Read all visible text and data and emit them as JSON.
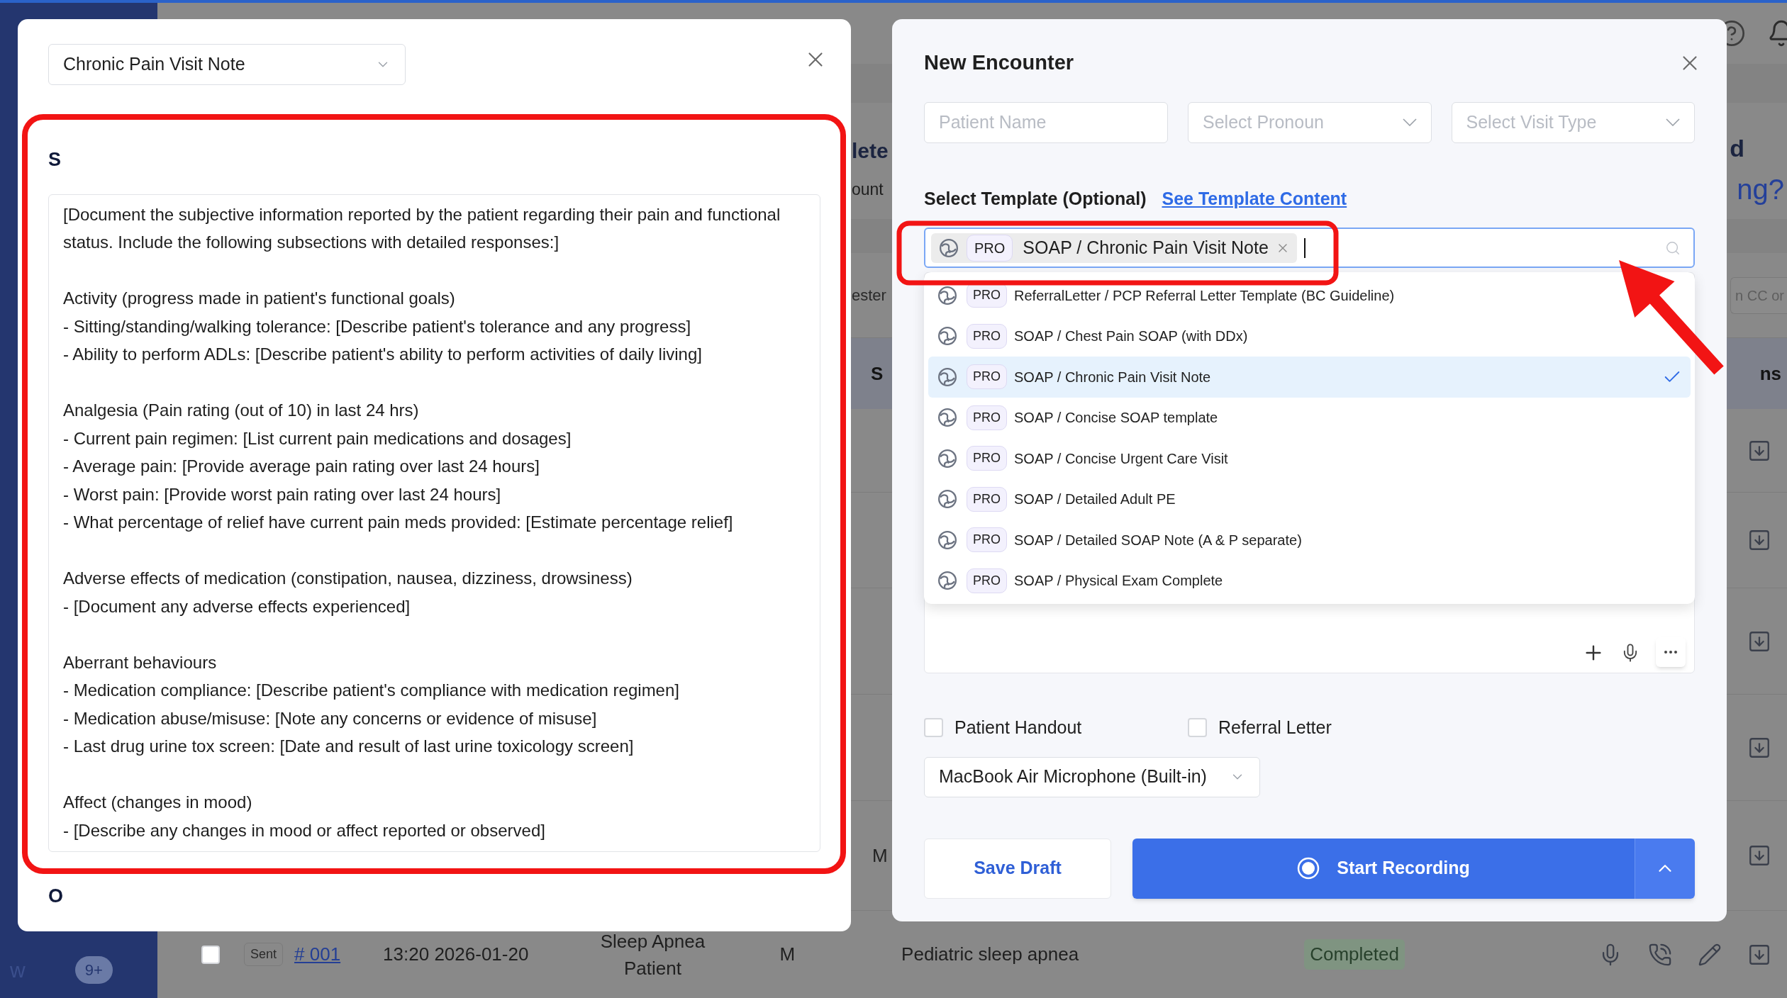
{
  "dashboard": {
    "header_left": "lete",
    "header_right": "d",
    "subheader_left": "ount",
    "question_right": "ng?",
    "filter_left": "ester",
    "filter_right": "n CC or",
    "table_header_left": "S",
    "table_header_right": "ns",
    "row_fragment": "M",
    "last_row": {
      "checked": false,
      "status": "Sent",
      "number": "# 001",
      "time": "13:20 2026-01-20",
      "patient": "Sleep Apnea Patient",
      "sex": "M",
      "reason": "Pediatric sleep apnea",
      "state": "Completed"
    },
    "sidebar_item": "w",
    "sidebar_badge": "9+"
  },
  "note_modal": {
    "template": "Chronic Pain Visit Note",
    "sections": [
      {
        "heading": "S",
        "body": "[Document the subjective information reported by the patient regarding their pain and functional status. Include the following subsections with detailed responses:]\n\nActivity (progress made in patient's functional goals)\n- Sitting/standing/walking tolerance: [Describe patient's tolerance and any progress]\n- Ability to perform ADLs: [Describe patient's ability to perform activities of daily living]\n\nAnalgesia (Pain rating (out of 10) in last 24 hrs)\n- Current pain regimen: [List current pain medications and dosages]\n- Average pain: [Provide average pain rating over last 24 hours]\n- Worst pain: [Provide worst pain rating over last 24 hours]\n- What percentage of relief have current pain meds provided: [Estimate percentage relief]\n\nAdverse effects of medication (constipation, nausea, dizziness, drowsiness)\n- [Document any adverse effects experienced]\n\nAberrant behaviours\n- Medication compliance: [Describe patient's compliance with medication regimen]\n- Medication abuse/misuse: [Note any concerns or evidence of misuse]\n- Last drug urine tox screen: [Date and result of last urine toxicology screen]\n\nAffect (changes in mood)\n- [Describe any changes in mood or affect reported or observed]"
      },
      {
        "heading": "O"
      }
    ]
  },
  "encounter_modal": {
    "title": "New Encounter",
    "fields": [
      {
        "kind": "text",
        "placeholder": "Patient Name"
      },
      {
        "kind": "select",
        "placeholder": "Select Pronoun"
      },
      {
        "kind": "select",
        "placeholder": "Select Visit Type"
      }
    ],
    "template_label": "Select Template (Optional)",
    "template_link": "See Template Content",
    "selected_template": {
      "badge": "PRO",
      "label": "SOAP / Chronic Pain Visit Note"
    },
    "options": [
      {
        "badge": "PRO",
        "label": "ReferralLetter / PCP Referral Letter Template (BC Guideline)",
        "selected": false
      },
      {
        "badge": "PRO",
        "label": "SOAP / Chest Pain SOAP (with DDx)",
        "selected": false
      },
      {
        "badge": "PRO",
        "label": "SOAP / Chronic Pain Visit Note",
        "selected": true
      },
      {
        "badge": "PRO",
        "label": "SOAP / Concise SOAP template",
        "selected": false
      },
      {
        "badge": "PRO",
        "label": "SOAP / Concise Urgent Care Visit",
        "selected": false
      },
      {
        "badge": "PRO",
        "label": "SOAP / Detailed Adult PE",
        "selected": false
      },
      {
        "badge": "PRO",
        "label": "SOAP / Detailed SOAP Note (A & P separate)",
        "selected": false
      },
      {
        "badge": "PRO",
        "label": "SOAP / Physical Exam Complete",
        "selected": false
      }
    ],
    "checkboxes": [
      {
        "label": "Patient Handout",
        "checked": false
      },
      {
        "label": "Referral Letter",
        "checked": false
      }
    ],
    "microphone": "MacBook Air Microphone (Built-in)",
    "buttons": {
      "save": "Save Draft",
      "record": "Start Recording"
    }
  }
}
